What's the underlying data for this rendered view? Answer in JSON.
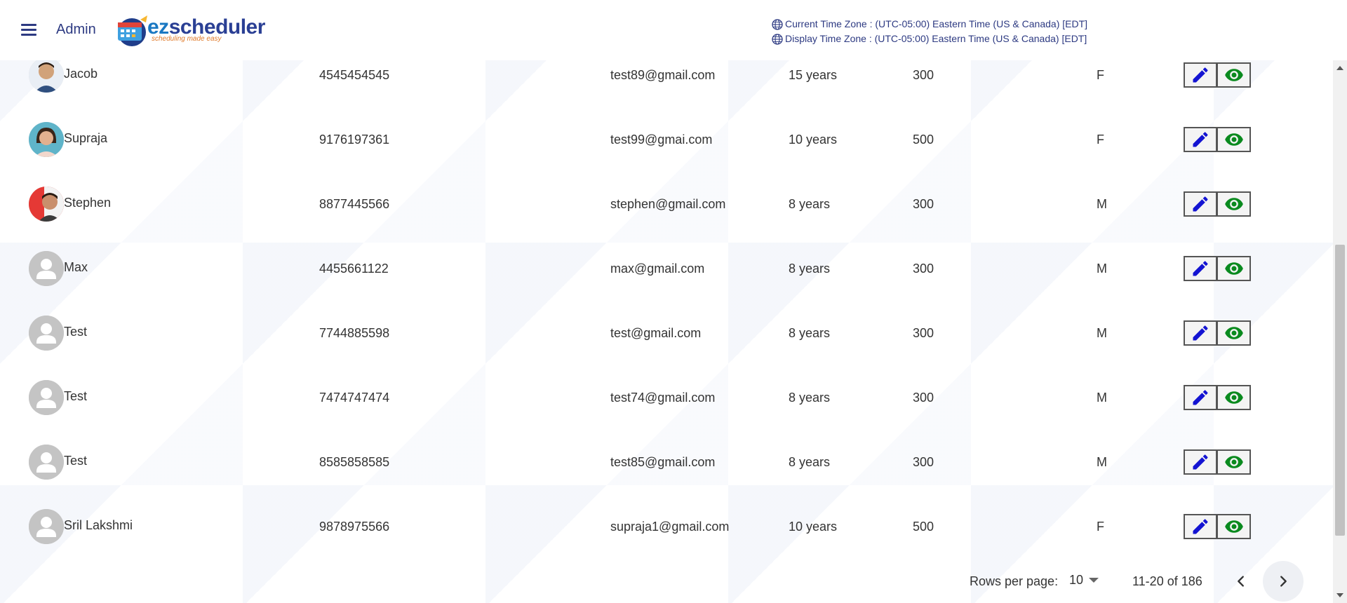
{
  "header": {
    "admin_label": "Admin",
    "logo_brand_prefix": "ez",
    "logo_brand_suffix": "scheduler",
    "logo_tagline": "scheduling made easy",
    "current_tz": "Current Time Zone : (UTC-05:00) Eastern Time (US & Canada) [EDT]",
    "display_tz": "Display Time Zone : (UTC-05:00) Eastern Time (US & Canada) [EDT]"
  },
  "rows": [
    {
      "name": "Jacob",
      "phone": "4545454545",
      "email": "test89@gmail.com",
      "experience": "15 years",
      "rate": "300",
      "gender": "F",
      "avatar": "photo-male-1"
    },
    {
      "name": "Supraja",
      "phone": "9176197361",
      "email": "test99@gmai.com",
      "experience": "10 years",
      "rate": "500",
      "gender": "F",
      "avatar": "photo-female"
    },
    {
      "name": "Stephen",
      "phone": "8877445566",
      "email": "stephen@gmail.com",
      "experience": "8 years",
      "rate": "300",
      "gender": "M",
      "avatar": "photo-male-2"
    },
    {
      "name": "Max",
      "phone": "4455661122",
      "email": "max@gmail.com",
      "experience": "8 years",
      "rate": "300",
      "gender": "M",
      "avatar": "default"
    },
    {
      "name": "Test",
      "phone": "7744885598",
      "email": "test@gmail.com",
      "experience": "8 years",
      "rate": "300",
      "gender": "M",
      "avatar": "default"
    },
    {
      "name": "Test",
      "phone": "7474747474",
      "email": "test74@gmail.com",
      "experience": "8 years",
      "rate": "300",
      "gender": "M",
      "avatar": "default"
    },
    {
      "name": "Test",
      "phone": "8585858585",
      "email": "test85@gmail.com",
      "experience": "8 years",
      "rate": "300",
      "gender": "M",
      "avatar": "default"
    },
    {
      "name": "Sril Lakshmi",
      "phone": "9878975566",
      "email": "supraja1@gmail.com",
      "experience": "10 years",
      "rate": "500",
      "gender": "F",
      "avatar": "default"
    }
  ],
  "pagination": {
    "rows_per_page_label": "Rows per page:",
    "rows_per_page_value": "10",
    "range_label": "11-20 of 186"
  },
  "colors": {
    "edit_icon": "#1414d2",
    "view_icon": "#0a8a1e",
    "brand": "#2a3f94"
  }
}
